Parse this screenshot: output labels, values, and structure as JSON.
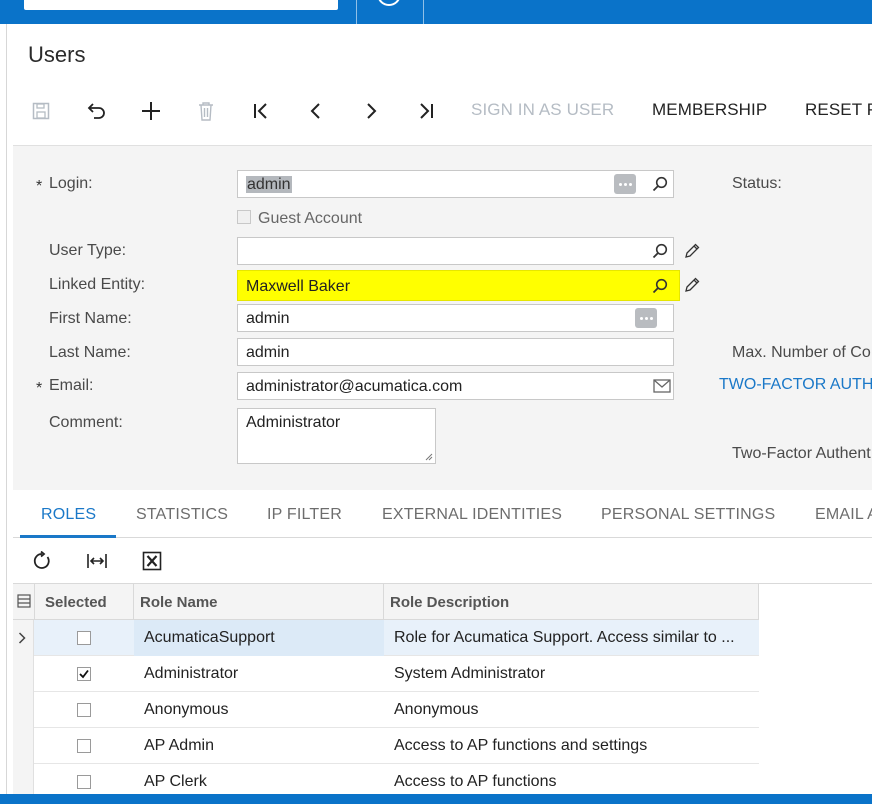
{
  "page": {
    "title": "Users"
  },
  "toolbar": {
    "sign_in_label": "SIGN IN AS USER",
    "membership_label": "MEMBERSHIP",
    "reset_label": "RESET P"
  },
  "form": {
    "login": {
      "label": "Login:",
      "value": "admin"
    },
    "guest_account_label": "Guest Account",
    "user_type": {
      "label": "User Type:",
      "value": ""
    },
    "linked_entity": {
      "label": "Linked Entity:",
      "value": "Maxwell Baker"
    },
    "first_name": {
      "label": "First Name:",
      "value": "admin"
    },
    "last_name": {
      "label": "Last Name:",
      "value": "admin"
    },
    "email": {
      "label": "Email:",
      "value": "administrator@acumatica.com"
    },
    "comment": {
      "label": "Comment:",
      "value": "Administrator"
    },
    "required_marker": "*",
    "right": {
      "status_label": "Status:",
      "max_connections_label": "Max. Number of Co",
      "two_factor_link": "TWO-FACTOR AUTH",
      "two_factor_label": "Two-Factor Authent"
    }
  },
  "tabs": [
    {
      "label": "ROLES",
      "active": true
    },
    {
      "label": "STATISTICS"
    },
    {
      "label": "IP FILTER"
    },
    {
      "label": "EXTERNAL IDENTITIES"
    },
    {
      "label": "PERSONAL SETTINGS"
    },
    {
      "label": "EMAIL A"
    }
  ],
  "grid": {
    "columns": [
      "Selected",
      "Role Name",
      "Role Description"
    ],
    "rows": [
      {
        "selected": false,
        "name": "AcumaticaSupport",
        "description": "Role for Acumatica Support. Access similar to ..."
      },
      {
        "selected": true,
        "name": "Administrator",
        "description": "System Administrator"
      },
      {
        "selected": false,
        "name": "Anonymous",
        "description": "Anonymous"
      },
      {
        "selected": false,
        "name": "AP Admin",
        "description": "Access to AP functions and settings"
      },
      {
        "selected": false,
        "name": "AP Clerk",
        "description": "Access to AP functions"
      }
    ]
  },
  "colors": {
    "brand_blue": "#0a73c9",
    "highlight_yellow": "#ffff00",
    "link_blue": "#1a78c8"
  },
  "icons": [
    "save-icon",
    "undo-icon",
    "add-icon",
    "delete-icon",
    "first-record-icon",
    "previous-icon",
    "next-icon",
    "last-record-icon",
    "lookup-icon",
    "ellipsis-icon",
    "edit-pencil-icon",
    "mail-icon",
    "refresh-icon",
    "fit-columns-icon",
    "excel-export-icon"
  ]
}
